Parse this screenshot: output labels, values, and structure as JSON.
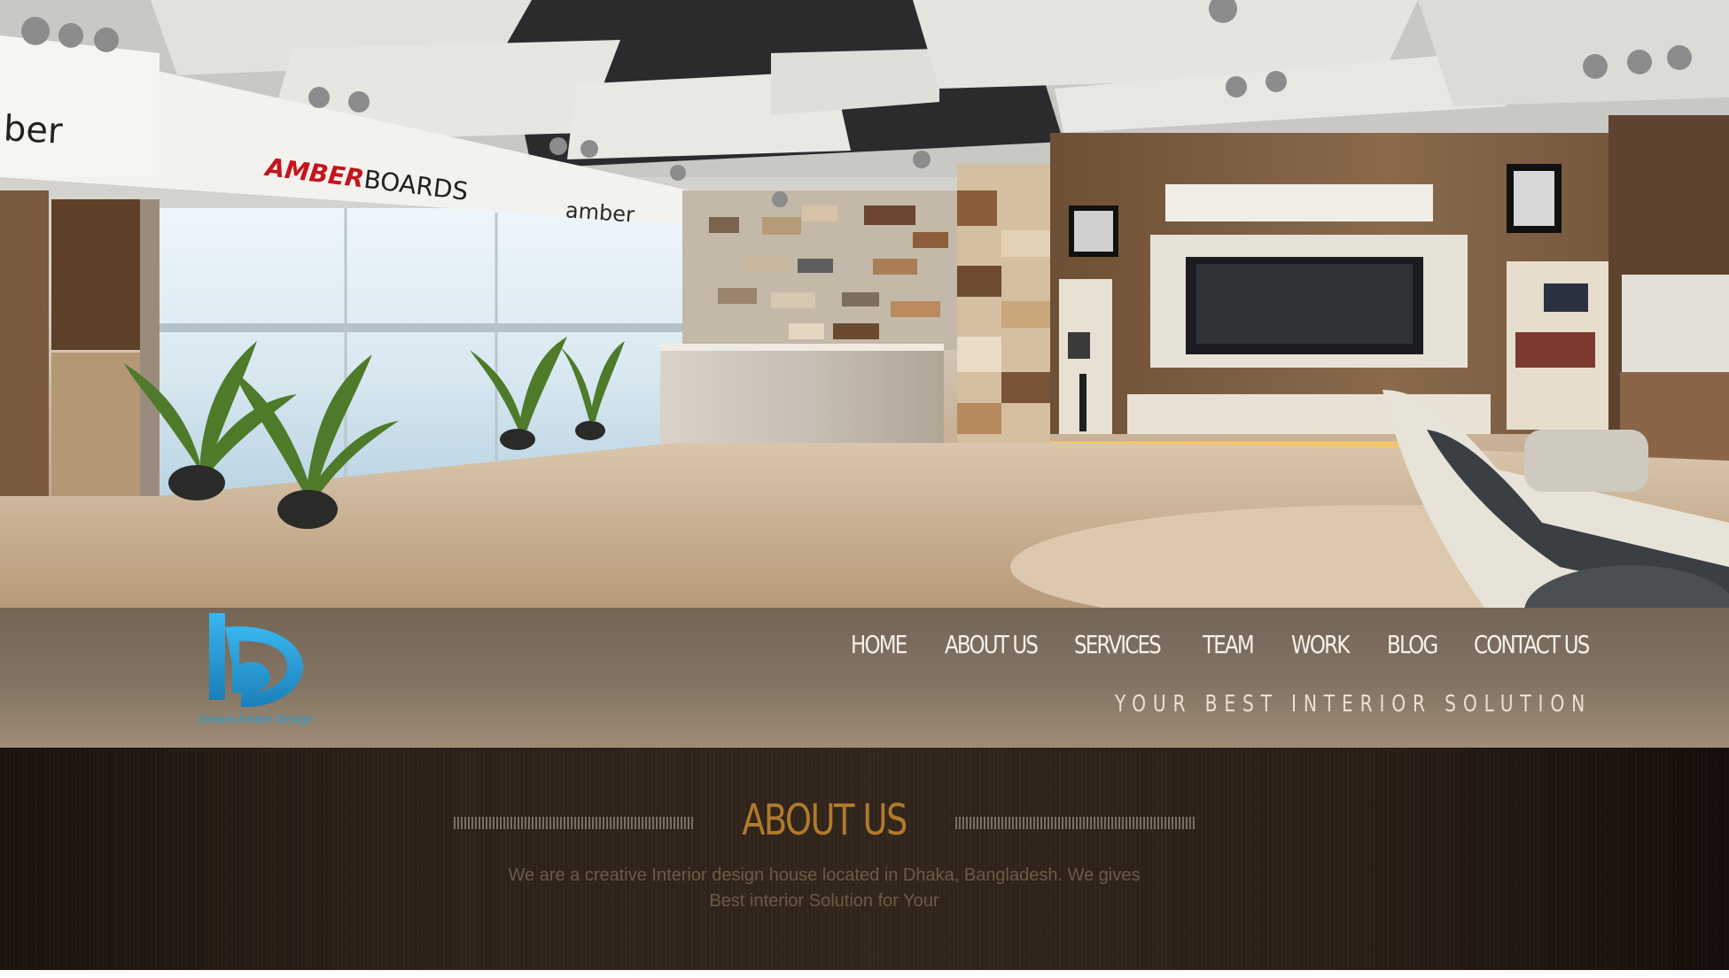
{
  "brand": {
    "logo_icon": "db-letter-logo",
    "logo_text": "Dream Amber Design"
  },
  "nav": {
    "items": [
      {
        "label": "HOME"
      },
      {
        "label": "ABOUT US"
      },
      {
        "label": "SERVICES"
      },
      {
        "label": "TEAM"
      },
      {
        "label": "WORK"
      },
      {
        "label": "BLOG"
      },
      {
        "label": "CONTACT US"
      }
    ],
    "tagline": "YOUR BEST INTERIOR SOLUTION"
  },
  "hero": {
    "signs": {
      "left": "ber",
      "amberboards_red": "AMBER",
      "amberboards_black": "BOARDS",
      "amber_small": "amber"
    }
  },
  "about": {
    "title": "ABOUT US",
    "text_line1": "We are a creative Interior design house located in Dhaka, Bangladesh. We gives",
    "text_line2": "Best interior Solution for Your"
  },
  "colors": {
    "nav_text": "#f6f2ea",
    "about_title": "#b07a2c",
    "about_text": "#6e5a44",
    "logo_blue": "#2a9fd6",
    "sign_red": "#c4141c"
  }
}
